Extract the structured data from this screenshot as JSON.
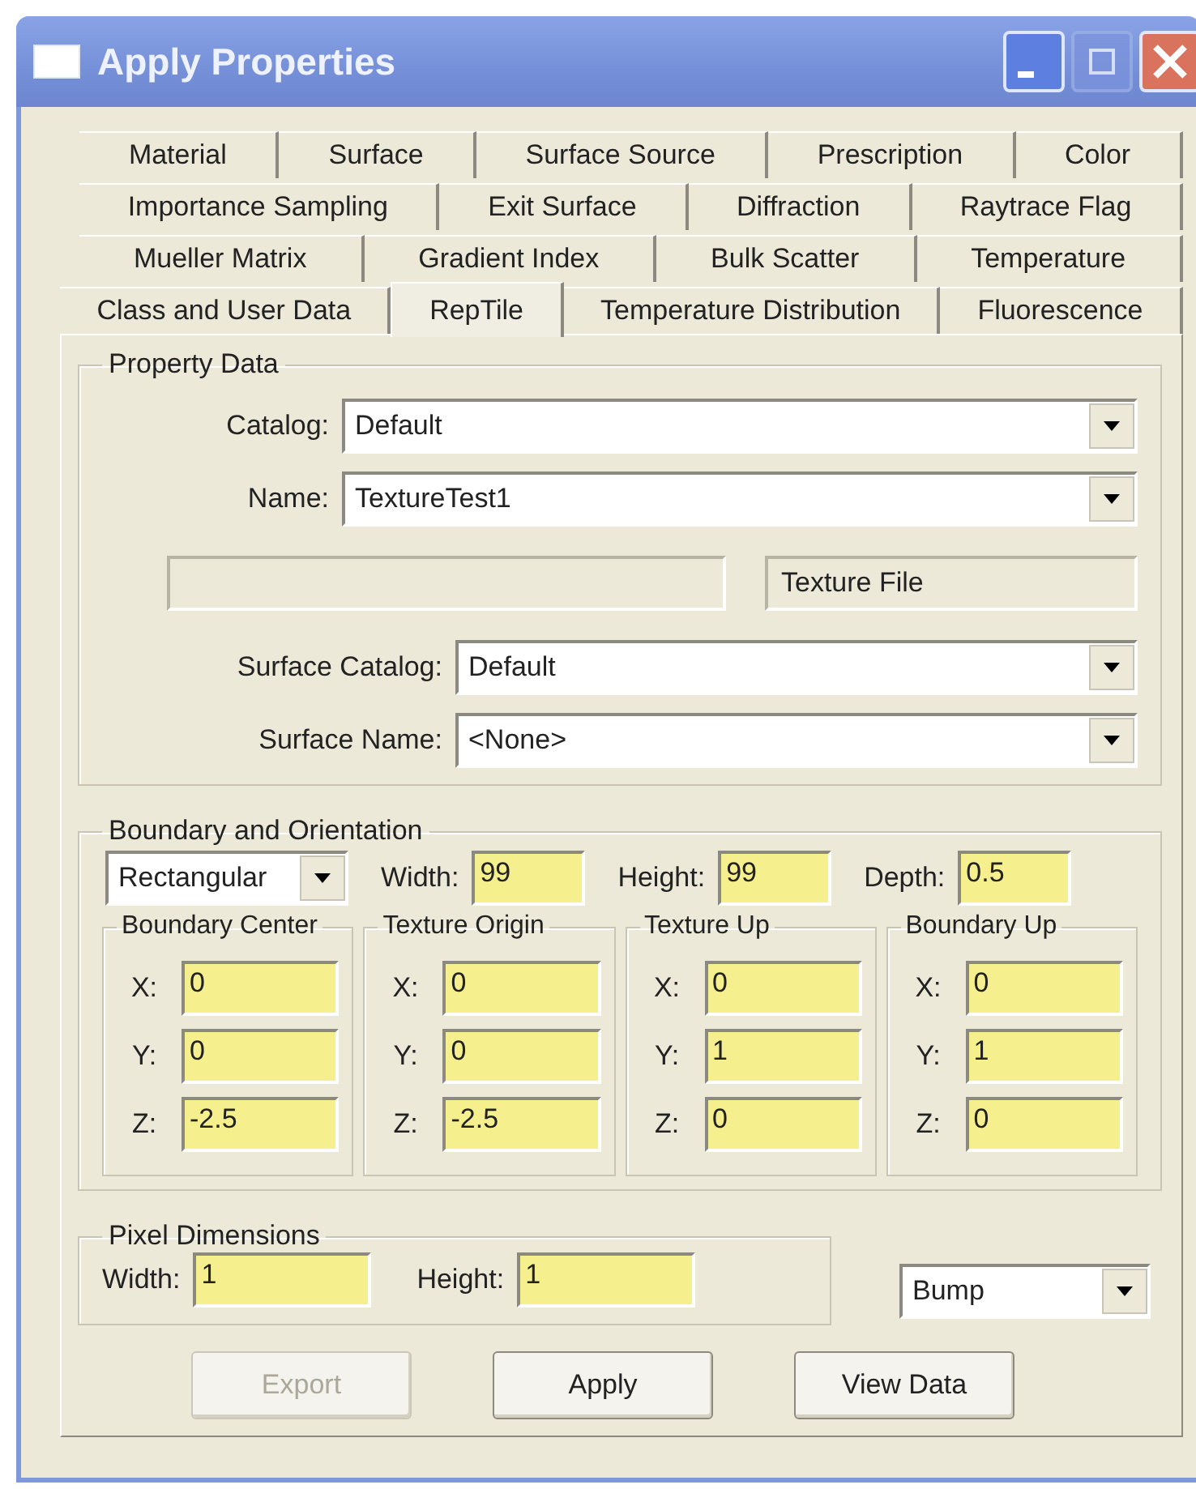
{
  "window": {
    "title": "Apply Properties",
    "controls": [
      {
        "kind": "minimize",
        "disabled": false
      },
      {
        "kind": "maximize",
        "disabled": true
      },
      {
        "kind": "close",
        "disabled": false
      }
    ]
  },
  "tab_rows": [
    [
      {
        "label": "Material",
        "selected": false
      },
      {
        "label": "Surface",
        "selected": false
      },
      {
        "label": "Surface Source",
        "selected": false
      },
      {
        "label": "Prescription",
        "selected": false
      },
      {
        "label": "Color",
        "selected": false
      }
    ],
    [
      {
        "label": "Importance Sampling",
        "selected": false
      },
      {
        "label": "Exit Surface",
        "selected": false
      },
      {
        "label": "Diffraction",
        "selected": false
      },
      {
        "label": "Raytrace Flag",
        "selected": false
      }
    ],
    [
      {
        "label": "Mueller Matrix",
        "selected": false
      },
      {
        "label": "Gradient Index",
        "selected": false
      },
      {
        "label": "Bulk Scatter",
        "selected": false
      },
      {
        "label": "Temperature",
        "selected": false
      }
    ],
    [
      {
        "label": "Class and User Data",
        "selected": false
      },
      {
        "label": "RepTile",
        "selected": true
      },
      {
        "label": "Temperature Distribution",
        "selected": false
      },
      {
        "label": "Fluorescence",
        "selected": false
      }
    ]
  ],
  "property_data": {
    "title": "Property Data",
    "catalog": {
      "label": "Catalog:",
      "value": "Default"
    },
    "name": {
      "label": "Name:",
      "value": "TextureTest1"
    },
    "texture_file_button": "Texture File",
    "surface_catalog": {
      "label": "Surface Catalog:",
      "value": "Default"
    },
    "surface_name": {
      "label": "Surface Name:",
      "value": "<None>"
    }
  },
  "boundary": {
    "title": "Boundary and Orientation",
    "shape": "Rectangular",
    "width": {
      "label": "Width:",
      "value": "99"
    },
    "height": {
      "label": "Height:",
      "value": "99"
    },
    "depth": {
      "label": "Depth:",
      "value": "0.5"
    },
    "groups": [
      {
        "title": "Boundary Center",
        "fields": [
          {
            "label": "X:",
            "value": "0"
          },
          {
            "label": "Y:",
            "value": "0"
          },
          {
            "label": "Z:",
            "value": "-2.5"
          }
        ]
      },
      {
        "title": "Texture Origin",
        "fields": [
          {
            "label": "X:",
            "value": "0"
          },
          {
            "label": "Y:",
            "value": "0"
          },
          {
            "label": "Z:",
            "value": "-2.5"
          }
        ]
      },
      {
        "title": "Texture Up",
        "fields": [
          {
            "label": "X:",
            "value": "0"
          },
          {
            "label": "Y:",
            "value": "1"
          },
          {
            "label": "Z:",
            "value": "0"
          }
        ]
      },
      {
        "title": "Boundary Up",
        "fields": [
          {
            "label": "X:",
            "value": "0"
          },
          {
            "label": "Y:",
            "value": "1"
          },
          {
            "label": "Z:",
            "value": "0"
          }
        ]
      }
    ]
  },
  "pixel_dimensions": {
    "title": "Pixel Dimensions",
    "width": {
      "label": "Width:",
      "value": "1"
    },
    "height": {
      "label": "Height:",
      "value": "1"
    }
  },
  "map_type": "Bump",
  "buttons": [
    {
      "label": "Export",
      "disabled": true
    },
    {
      "label": "Apply",
      "disabled": false
    },
    {
      "label": "View Data",
      "disabled": false
    }
  ]
}
